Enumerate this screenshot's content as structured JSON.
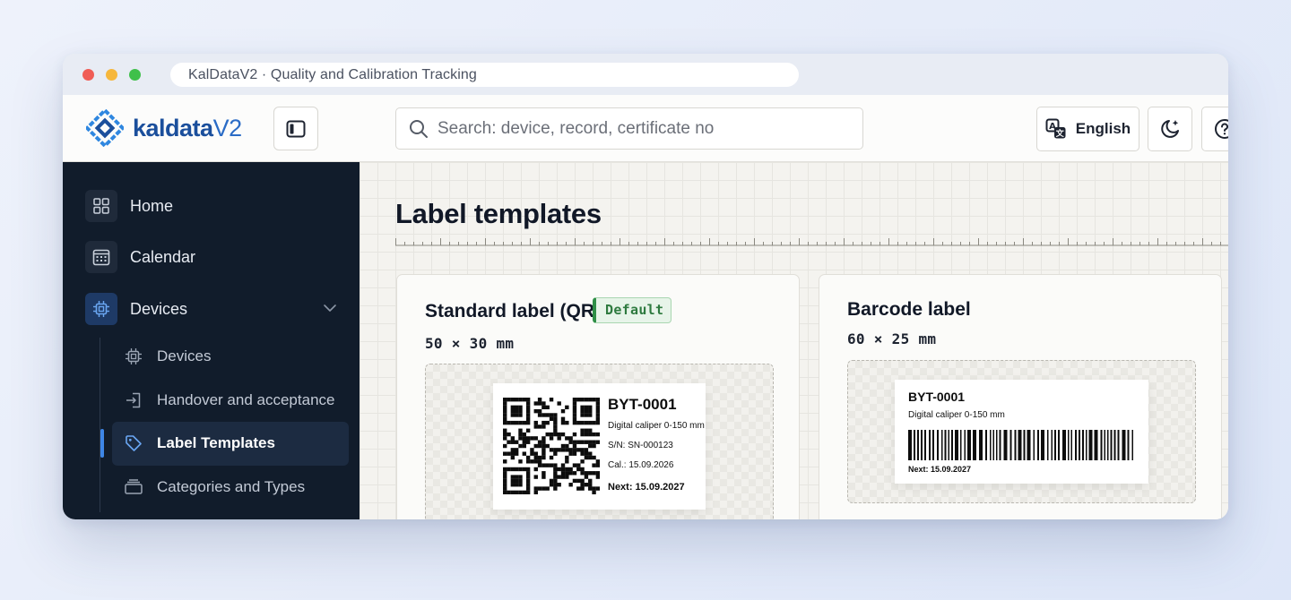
{
  "browser": {
    "tab_title": "KalDataV2 · Quality and Calibration Tracking"
  },
  "header": {
    "logo_main": "kaldata",
    "logo_suffix": "V2",
    "search_placeholder": "Search: device, record, certificate no",
    "language_label": "English"
  },
  "sidebar": {
    "items": [
      {
        "label": "Home",
        "icon": "grid-icon"
      },
      {
        "label": "Calendar",
        "icon": "calendar-icon"
      },
      {
        "label": "Devices",
        "icon": "chip-icon"
      }
    ],
    "sub_items": [
      {
        "label": "Devices",
        "icon": "chip-icon"
      },
      {
        "label": "Handover and acceptance",
        "icon": "login-arrow-icon"
      },
      {
        "label": "Label Templates",
        "icon": "tag-icon"
      },
      {
        "label": "Categories and Types",
        "icon": "stack-icon"
      }
    ]
  },
  "main": {
    "title": "Label templates",
    "templates": [
      {
        "title": "Standard label (QR)",
        "badge": "Default",
        "dims": "50 × 30 mm",
        "label": {
          "id": "BYT-0001",
          "desc": "Digital caliper 0-150 mm",
          "serial": "S/N: SN-000123",
          "cal": "Cal.: 15.09.2026",
          "next": "Next: 15.09.2027"
        }
      },
      {
        "title": "Barcode label",
        "dims": "60 × 25 mm",
        "label": {
          "id": "BYT-0001",
          "desc": "Digital caliper 0-150 mm",
          "next": "Next: 15.09.2027"
        }
      }
    ]
  },
  "colors": {
    "sidebar_bg": "#111c2b",
    "accent": "#3e86e6",
    "brand": "#1b4f9c",
    "badge_green": "#2f8f47"
  }
}
